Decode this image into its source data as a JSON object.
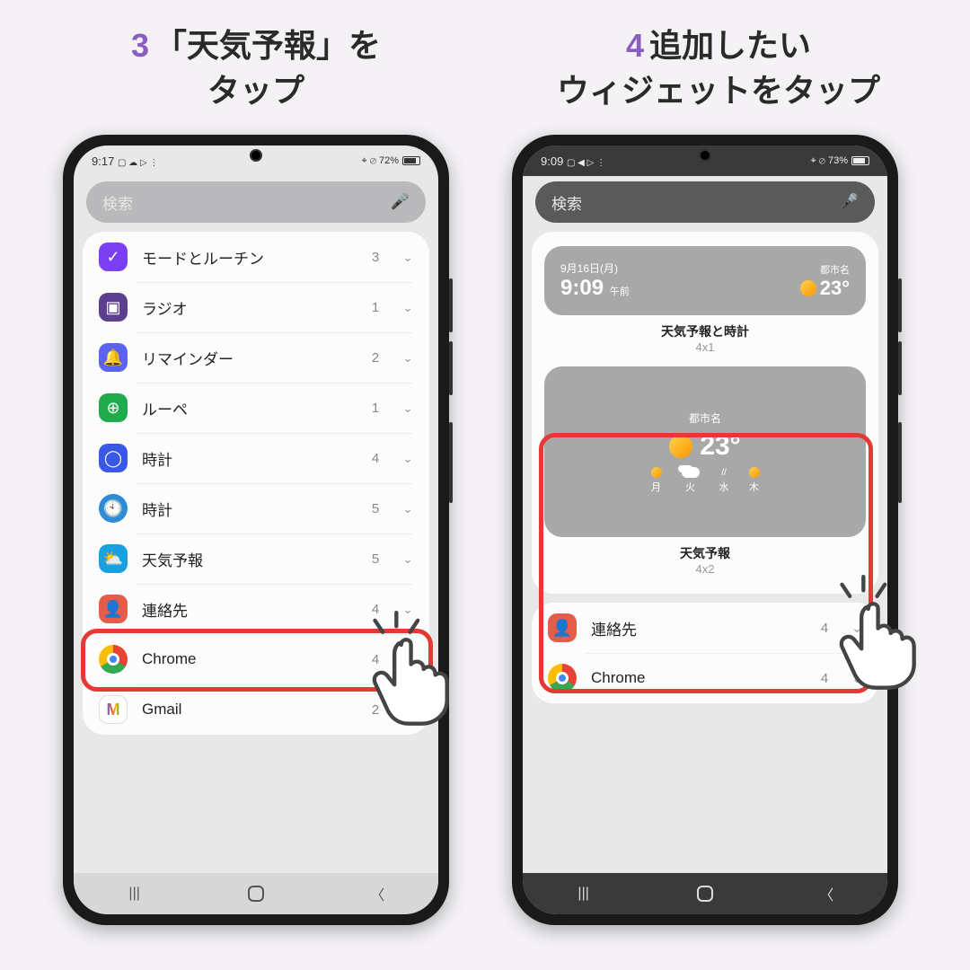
{
  "step3": {
    "num": "3",
    "title_l1": "「天気予報」を",
    "title_l2": "タップ",
    "status_time": "9:17",
    "status_icons": "▢ ☁ ▷ ⋮",
    "status_right": "⌖ ⊘ 72%",
    "search_placeholder": "検索",
    "rows": [
      {
        "icon_bg": "#7b3ff2",
        "icon_glyph": "✓",
        "label": "モードとルーチン",
        "count": "3"
      },
      {
        "icon_bg": "#5d3f8f",
        "icon_glyph": "▣",
        "label": "ラジオ",
        "count": "1"
      },
      {
        "icon_bg": "#5b63ef",
        "icon_glyph": "🔔",
        "label": "リマインダー",
        "count": "2"
      },
      {
        "icon_bg": "#1fab4c",
        "icon_glyph": "⊕",
        "label": "ルーペ",
        "count": "1"
      },
      {
        "icon_bg": "#3a58e8",
        "icon_glyph": "◯",
        "label": "時計",
        "count": "4"
      },
      {
        "icon_bg": "#2d8bd8",
        "icon_glyph": "🕙",
        "icon_round": true,
        "label": "時計",
        "count": "5"
      },
      {
        "icon_bg": "#18a0e0",
        "icon_glyph": "⛅",
        "label": "天気予報",
        "count": "5"
      },
      {
        "icon_bg": "#e45c4a",
        "icon_glyph": "👤",
        "label": "連絡先",
        "count": "4"
      },
      {
        "icon_bg": "#ffffff",
        "icon_glyph": "◉",
        "icon_chrome": true,
        "label": "Chrome",
        "count": "4"
      },
      {
        "icon_bg": "#ffffff",
        "icon_glyph": "M",
        "icon_gmail": true,
        "label": "Gmail",
        "count": "2"
      }
    ]
  },
  "step4": {
    "num": "4",
    "title_l1": "追加したい",
    "title_l2": "ウィジェットをタップ",
    "status_time": "9:09",
    "status_icons": "▢ ◀ ▷ ⋮",
    "status_right": "⌖ ⊘ 73%",
    "search_placeholder": "検索",
    "widget1": {
      "date": "9月16日(月)",
      "time": "9:09",
      "ampm": "午前",
      "city": "都市名",
      "temp": "23°",
      "title": "天気予報と時計",
      "size": "4x1"
    },
    "widget2": {
      "city": "都市名",
      "temp": "23°",
      "days": [
        "月",
        "火",
        "水",
        "木"
      ],
      "title": "天気予報",
      "size": "4x2"
    },
    "rows": [
      {
        "icon_bg": "#e45c4a",
        "icon_glyph": "👤",
        "label": "連絡先",
        "count": "4"
      },
      {
        "icon_bg": "#ffffff",
        "icon_chrome": true,
        "label": "Chrome",
        "count": "4"
      }
    ]
  },
  "mic_glyph": "🎤",
  "chevron": "⌄"
}
